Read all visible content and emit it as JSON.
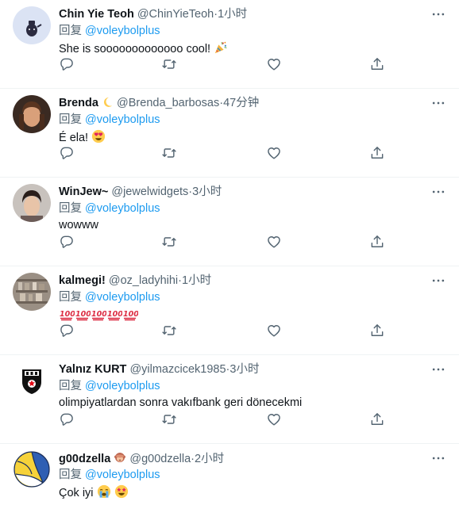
{
  "feed": {
    "tweets": [
      {
        "name": "Chin Yie Teoh",
        "name_emoji": "",
        "handle": "@ChinYieTeoh",
        "separator": "·",
        "time": "1小时",
        "reply_prefix": "回复",
        "reply_mention": "@voleybolplus",
        "text": "She is sooooooooooooo cool!",
        "text_emoji": [
          "partying-face"
        ],
        "avatar": "kettle-cartoon-avatar"
      },
      {
        "name": "Brenda",
        "name_emoji": "crescent-moon",
        "handle": "@Brenda_barbosas",
        "separator": "·",
        "time": "47分钟",
        "reply_prefix": "回复",
        "reply_mention": "@voleybolplus",
        "text": "É ela!",
        "text_emoji": [
          "heart-eyes"
        ],
        "avatar": "woman-photo-avatar"
      },
      {
        "name": "WinJew~",
        "name_emoji": "",
        "handle": "@jewelwidgets",
        "separator": "·",
        "time": "3小时",
        "reply_prefix": "回复",
        "reply_mention": "@voleybolplus",
        "text": "wowww",
        "text_emoji": [],
        "avatar": "man-photo-avatar"
      },
      {
        "name": "kalmegi!",
        "name_emoji": "",
        "handle": "@oz_ladyhihi",
        "separator": "·",
        "time": "1小时",
        "reply_prefix": "回复",
        "reply_mention": "@voleybolplus",
        "text": "",
        "text_emoji": [
          "hundred-points",
          "hundred-points",
          "hundred-points",
          "hundred-points",
          "hundred-points"
        ],
        "avatar": "shelves-photo-avatar"
      },
      {
        "name": "Yalnız KURT",
        "name_emoji": "",
        "handle": "@yilmazcicek1985",
        "separator": "·",
        "time": "3小时",
        "reply_prefix": "回复",
        "reply_mention": "@voleybolplus",
        "text": "olimpiyatlardan sonra vakıfbank geri dönecekmi",
        "text_emoji": [],
        "avatar": "besiktas-crest-avatar"
      },
      {
        "name": "g00dzella",
        "name_emoji": "see-no-evil-monkey",
        "handle": "@g00dzella",
        "separator": "·",
        "time": "2小时",
        "reply_prefix": "回复",
        "reply_mention": "@voleybolplus",
        "text": "Çok iyi",
        "text_emoji": [
          "loudly-crying-face",
          "star-struck"
        ],
        "avatar": "volleyball-avatar"
      }
    ]
  },
  "icons": {
    "more": "more-horizontal-icon",
    "reply": "reply-icon",
    "retweet": "retweet-icon",
    "like": "like-heart-icon",
    "share": "share-icon"
  },
  "colors": {
    "link": "#1d9bf0",
    "secondary_text": "#536471",
    "primary_text": "#0f1419",
    "divider": "#eff3f4"
  }
}
